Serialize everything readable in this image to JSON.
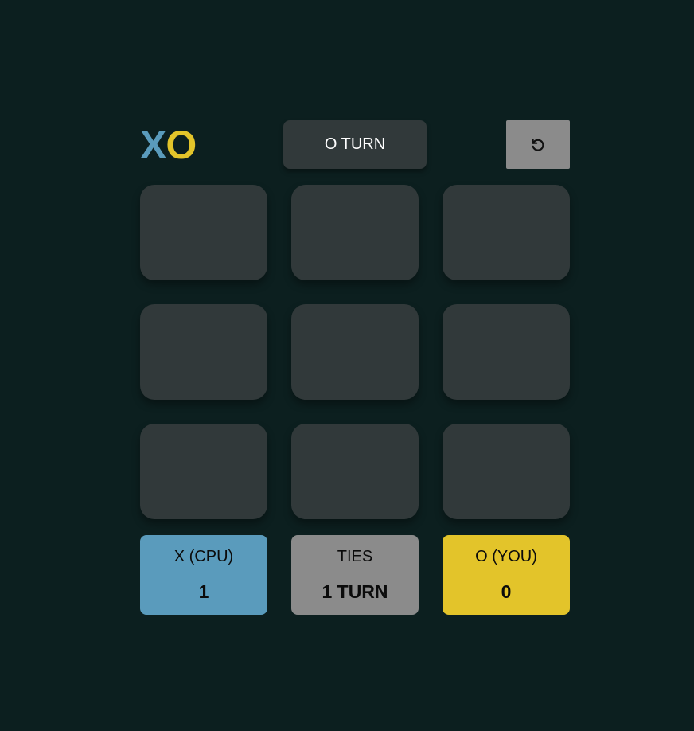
{
  "logo": {
    "x": "X",
    "o": "O"
  },
  "status": {
    "turn": "O TURN"
  },
  "reset": {
    "icon": "reset-icon"
  },
  "board": {
    "cells": [
      "",
      "",
      "",
      "",
      "",
      "",
      "",
      "",
      ""
    ]
  },
  "scores": {
    "x": {
      "label": "X (CPU)",
      "value": "1"
    },
    "ties": {
      "label": "TIES",
      "value": "1 TURN"
    },
    "o": {
      "label": "O (YOU)",
      "value": "0"
    }
  },
  "colors": {
    "background": "#0c1f1f",
    "cell": "#31393a",
    "x_accent": "#5a9bbc",
    "o_accent": "#e3c42a",
    "neutral": "#8b8b8b"
  }
}
